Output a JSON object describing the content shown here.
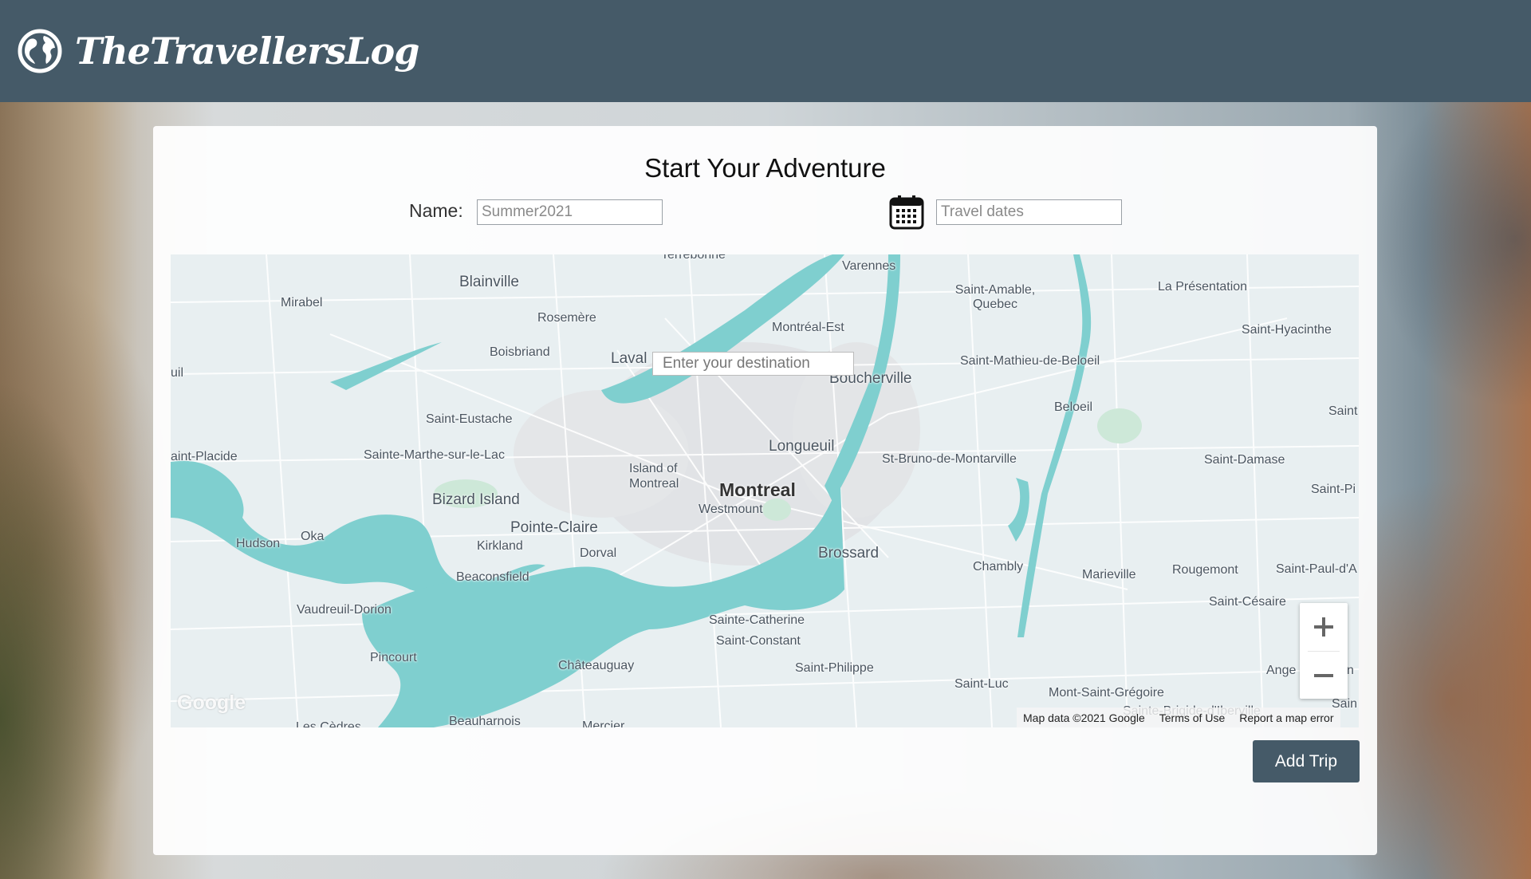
{
  "header": {
    "brand": "TheTravellersLog",
    "logo_icon": "globe-icon"
  },
  "form": {
    "title": "Start Your Adventure",
    "name_label": "Name:",
    "name_placeholder": "Summer2021",
    "calendar_icon": "calendar-icon",
    "dates_placeholder": "Travel dates"
  },
  "map": {
    "destination_placeholder": "Enter your destination",
    "places": [
      "Terrebonne",
      "Varennes",
      "Blainville",
      "Mirabel",
      "Rosemère",
      "Montréal-Est",
      "Saint-Amable, Quebec",
      "La Présentation",
      "Saint-Hyacinthe",
      "Boisbriand",
      "Laval",
      "Boucherville",
      "Saint-Mathieu-de-Beloeil",
      "uil",
      "Beloeil",
      "Saint-Eustache",
      "Saint",
      "Longueuil",
      "aint-Placide",
      "Sainte-Marthe-sur-le-Lac",
      "St-Bruno-de-Montarville",
      "Saint-Damase",
      "Island of Montreal",
      "Montreal",
      "Saint-Pi",
      "Bizard Island",
      "Westmount",
      "Pointe-Claire",
      "Hudson",
      "Oka",
      "Kirkland",
      "Brossard",
      "Dorval",
      "Chambly",
      "Marieville",
      "Rougemont",
      "Saint-Paul-d'A",
      "Beaconsfield",
      "Saint-Césaire",
      "Vaudreuil-Dorion",
      "Sainte-Catherine",
      "Saint-Constant",
      "Pincourt",
      "Ange",
      "n",
      "Châteauguay",
      "Saint-Philippe",
      "Saint-Luc",
      "Mont-Saint-Grégoire",
      "Sain",
      "Sainte-Brigide-d'Iberville",
      "Beauharnois",
      "Mercier",
      "Les Cèdres"
    ],
    "google_logo": "Google",
    "attribution": {
      "data": "Map data ©2021 Google",
      "terms": "Terms of Use",
      "report": "Report a map error"
    },
    "zoom_in_icon": "plus-icon",
    "zoom_out_icon": "minus-icon"
  },
  "actions": {
    "add_trip": "Add Trip"
  },
  "colors": {
    "header": "#455a68",
    "water": "#7fcfcf",
    "button": "#455a68"
  }
}
